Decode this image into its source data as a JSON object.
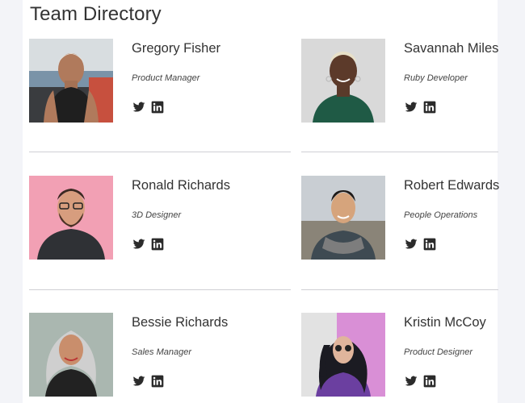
{
  "page": {
    "title": "Team Directory"
  },
  "icons": {
    "twitter": "twitter-icon",
    "linkedin": "linkedin-icon"
  },
  "colors": {
    "icon": "#2b2b2b",
    "divider": "#cfcfd4"
  },
  "members": [
    {
      "name": "Gregory Fisher",
      "role": "Product Manager"
    },
    {
      "name": "Savannah Miles",
      "role": "Ruby Developer"
    },
    {
      "name": "Ronald Richards",
      "role": "3D Designer"
    },
    {
      "name": "Robert Edwards",
      "role": "People Operations"
    },
    {
      "name": "Bessie Richards",
      "role": "Sales Manager"
    },
    {
      "name": "Kristin McCoy",
      "role": "Product Designer"
    }
  ]
}
